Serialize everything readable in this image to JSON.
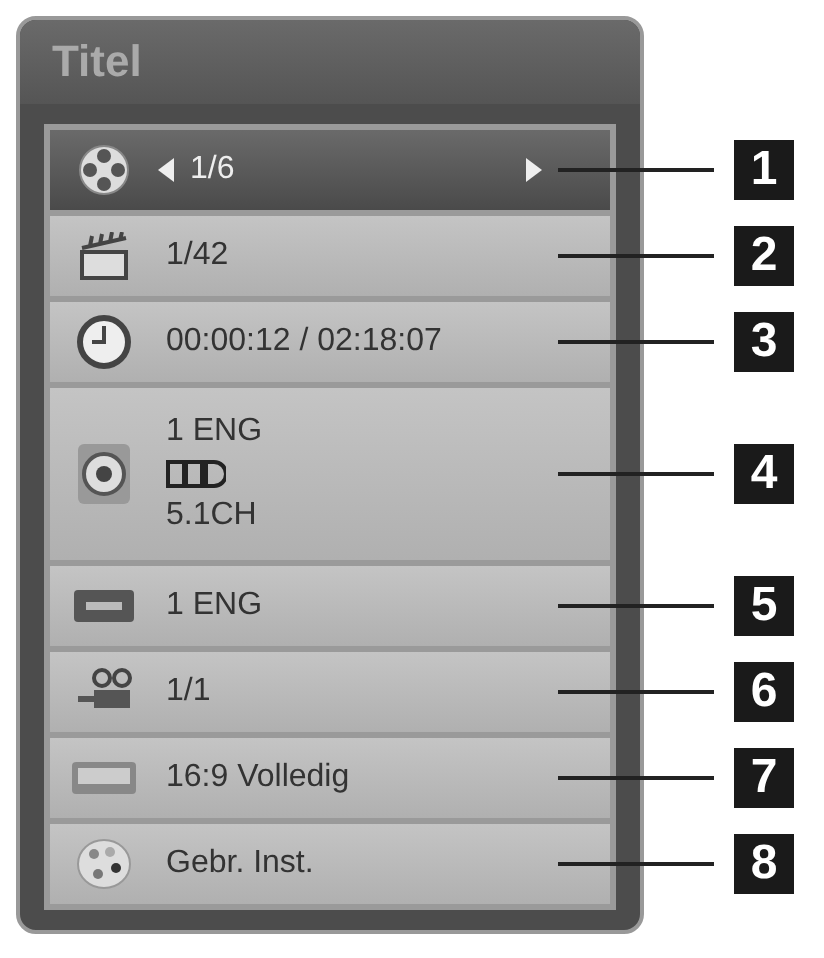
{
  "menu": {
    "title": "Titel",
    "rows": [
      {
        "kind": "title",
        "selected": true,
        "callout": "1",
        "lines": [
          {
            "kind": "text",
            "text": "1/6"
          }
        ]
      },
      {
        "kind": "chapter",
        "selected": false,
        "callout": "2",
        "lines": [
          {
            "kind": "text",
            "text": "1/42"
          }
        ]
      },
      {
        "kind": "time",
        "selected": false,
        "callout": "3",
        "lines": [
          {
            "kind": "text",
            "text": "00:00:12 / 02:18:07"
          }
        ]
      },
      {
        "kind": "audio",
        "selected": false,
        "callout": "4",
        "lines": [
          {
            "kind": "text",
            "text": "1 ENG"
          },
          {
            "kind": "dolby"
          },
          {
            "kind": "text",
            "text": "5.1CH"
          }
        ]
      },
      {
        "kind": "subtitle",
        "selected": false,
        "callout": "5",
        "lines": [
          {
            "kind": "text",
            "text": "1 ENG"
          }
        ]
      },
      {
        "kind": "angle",
        "selected": false,
        "callout": "6",
        "lines": [
          {
            "kind": "text",
            "text": "1/1"
          }
        ]
      },
      {
        "kind": "aspect",
        "selected": false,
        "callout": "7",
        "lines": [
          {
            "kind": "text",
            "text": "16:9 Volledig"
          }
        ]
      },
      {
        "kind": "mode",
        "selected": false,
        "callout": "8",
        "lines": [
          {
            "kind": "text",
            "text": "Gebr. Inst."
          }
        ]
      }
    ]
  }
}
